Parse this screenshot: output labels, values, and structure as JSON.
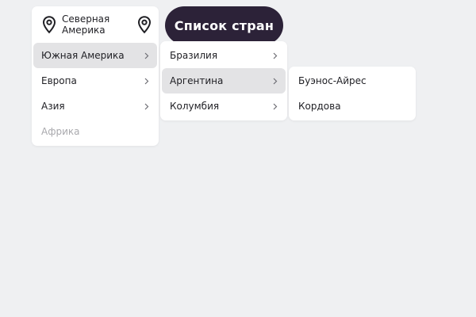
{
  "regions_menu": {
    "header_label": "Северная\nАмерика",
    "items": [
      {
        "label": "Южная Америка",
        "active": true,
        "has_submenu": true
      },
      {
        "label": "Европа",
        "active": false,
        "has_submenu": true
      },
      {
        "label": "Азия",
        "active": false,
        "has_submenu": true
      },
      {
        "label": "Африка",
        "active": false,
        "disabled": true,
        "has_submenu": false
      }
    ]
  },
  "country_list_button": {
    "label": "Список стран"
  },
  "countries_menu": {
    "items": [
      {
        "label": "Бразилия",
        "active": false,
        "has_submenu": true
      },
      {
        "label": "Аргентина",
        "active": true,
        "has_submenu": true
      },
      {
        "label": "Колумбия",
        "active": false,
        "has_submenu": true
      }
    ]
  },
  "cities_menu": {
    "items": [
      {
        "label": "Буэнос-Айрес"
      },
      {
        "label": "Кордова"
      }
    ]
  },
  "colors": {
    "background": "#eff0f2",
    "button": "#2c2238",
    "active_item": "#e3e3e5",
    "disabled_text": "#a9a9ad"
  },
  "icons": {
    "header_left": "map-pin-icon",
    "header_right": "map-pin-icon",
    "submenu_arrow": "chevron-right-icon"
  }
}
